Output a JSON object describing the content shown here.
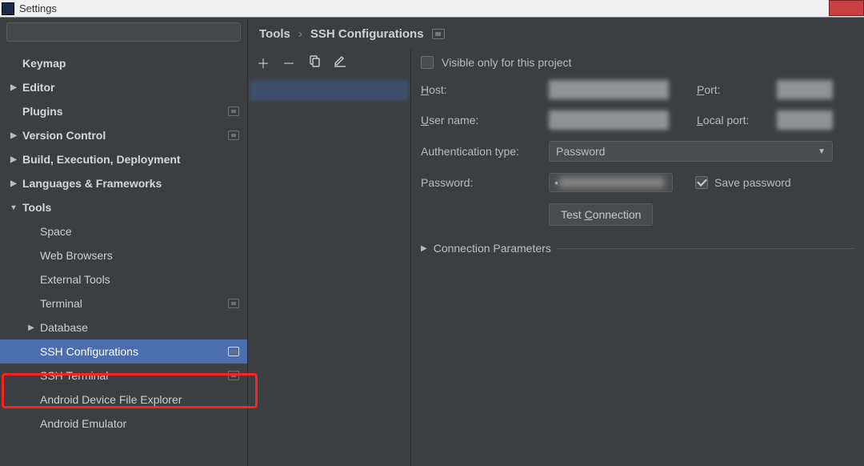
{
  "window": {
    "title": "Settings"
  },
  "search": {
    "placeholder": ""
  },
  "tree": {
    "keymap": "Keymap",
    "editor": "Editor",
    "plugins": "Plugins",
    "version_control": "Version Control",
    "build": "Build, Execution, Deployment",
    "languages": "Languages & Frameworks",
    "tools": "Tools",
    "tools_children": {
      "space": "Space",
      "web_browsers": "Web Browsers",
      "external_tools": "External Tools",
      "terminal": "Terminal",
      "database": "Database",
      "ssh_configurations": "SSH Configurations",
      "ssh_terminal": "SSH Terminal",
      "adfe": "Android Device File Explorer",
      "emulator": "Android Emulator"
    }
  },
  "breadcrumb": {
    "root": "Tools",
    "leaf": "SSH Configurations"
  },
  "form": {
    "visible_only": "Visible only for this project",
    "visible_only_checked": false,
    "host_label": "Host:",
    "port_label": "Port:",
    "user_label": "User name:",
    "local_port_label": "Local port:",
    "auth_label": "Authentication type:",
    "auth_value": "Password",
    "password_label": "Password:",
    "password_value": "•",
    "save_password_label": "Save password",
    "save_password_checked": true,
    "test_connection": "Test Connection",
    "conn_params": "Connection Parameters"
  }
}
